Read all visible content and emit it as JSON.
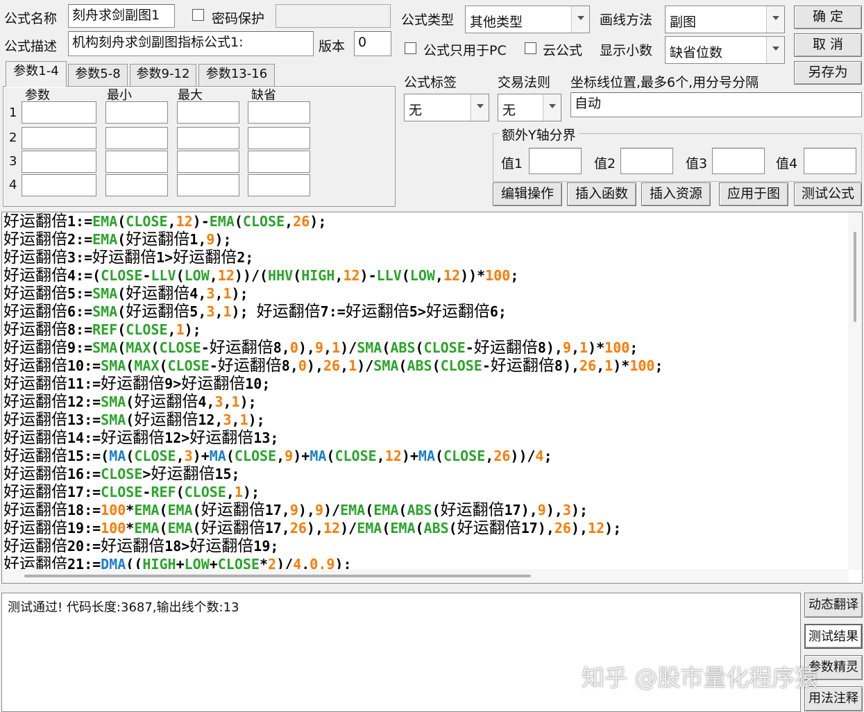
{
  "header": {
    "name_label": "公式名称",
    "name_value": "刻舟求剑副图1",
    "password_label": "密码保护",
    "password_value": "",
    "desc_label": "公式描述",
    "desc_value": "机构刻舟求剑副图指标公式1:",
    "version_label": "版本",
    "version_value": "0",
    "type_label": "公式类型",
    "type_value": "其他类型",
    "draw_label": "画线方法",
    "draw_value": "副图",
    "pc_only_label": "公式只用于PC",
    "cloud_label": "云公式",
    "decimals_label": "显示小数",
    "decimals_value": "缺省位数",
    "tag_label": "公式标签",
    "tag_value": "无",
    "trade_label": "交易法则",
    "trade_value": "无",
    "axis_label": "坐标线位置,最多6个,用分号分隔",
    "axis_value": "自动",
    "extra_y_label": "额外Y轴分界",
    "extra_y": [
      "值1",
      "值2",
      "值3",
      "值4"
    ]
  },
  "buttons": {
    "ok": "确 定",
    "cancel": "取 消",
    "save_as": "另存为",
    "edit_op": "编辑操作",
    "insert_fn": "插入函数",
    "insert_res": "插入资源",
    "apply": "应用于图",
    "test": "测试公式"
  },
  "tabs": [
    "参数1-4",
    "参数5-8",
    "参数9-12",
    "参数13-16"
  ],
  "params": {
    "headers": [
      "参数",
      "最小",
      "最大",
      "缺省"
    ],
    "rows": [
      "1",
      "2",
      "3",
      "4"
    ]
  },
  "code_lines": [
    [
      [
        "cn",
        "好运翻倍"
      ],
      [
        "t",
        "1:="
      ],
      [
        "kw",
        "EMA"
      ],
      [
        "t",
        "("
      ],
      [
        "kw",
        "CLOSE"
      ],
      [
        "t",
        ","
      ],
      [
        "num",
        "12"
      ],
      [
        "t",
        ")-"
      ],
      [
        "kw",
        "EMA"
      ],
      [
        "t",
        "("
      ],
      [
        "kw",
        "CLOSE"
      ],
      [
        "t",
        ","
      ],
      [
        "num",
        "26"
      ],
      [
        "t",
        ");"
      ]
    ],
    [
      [
        "cn",
        "好运翻倍"
      ],
      [
        "t",
        "2:="
      ],
      [
        "kw",
        "EMA"
      ],
      [
        "t",
        "("
      ],
      [
        "cn",
        "好运翻倍"
      ],
      [
        "t",
        "1,"
      ],
      [
        "num",
        "9"
      ],
      [
        "t",
        ");"
      ]
    ],
    [
      [
        "cn",
        "好运翻倍"
      ],
      [
        "t",
        "3:="
      ],
      [
        "cn",
        "好运翻倍"
      ],
      [
        "t",
        "1>"
      ],
      [
        "cn",
        "好运翻倍"
      ],
      [
        "t",
        "2;"
      ]
    ],
    [
      [
        "cn",
        "好运翻倍"
      ],
      [
        "t",
        "4:=("
      ],
      [
        "kw",
        "CLOSE"
      ],
      [
        "t",
        "-"
      ],
      [
        "kw",
        "LLV"
      ],
      [
        "t",
        "("
      ],
      [
        "kw",
        "LOW"
      ],
      [
        "t",
        ","
      ],
      [
        "num",
        "12"
      ],
      [
        "t",
        "))/("
      ],
      [
        "kw",
        "HHV"
      ],
      [
        "t",
        "("
      ],
      [
        "kw",
        "HIGH"
      ],
      [
        "t",
        ","
      ],
      [
        "num",
        "12"
      ],
      [
        "t",
        ")-"
      ],
      [
        "kw",
        "LLV"
      ],
      [
        "t",
        "("
      ],
      [
        "kw",
        "LOW"
      ],
      [
        "t",
        ","
      ],
      [
        "num",
        "12"
      ],
      [
        "t",
        "))*"
      ],
      [
        "num",
        "100"
      ],
      [
        "t",
        ";"
      ]
    ],
    [
      [
        "cn",
        "好运翻倍"
      ],
      [
        "t",
        "5:="
      ],
      [
        "kw",
        "SMA"
      ],
      [
        "t",
        "("
      ],
      [
        "cn",
        "好运翻倍"
      ],
      [
        "t",
        "4,"
      ],
      [
        "num",
        "3"
      ],
      [
        "t",
        ","
      ],
      [
        "num",
        "1"
      ],
      [
        "t",
        ");"
      ]
    ],
    [
      [
        "cn",
        "好运翻倍"
      ],
      [
        "t",
        "6:="
      ],
      [
        "kw",
        "SMA"
      ],
      [
        "t",
        "("
      ],
      [
        "cn",
        "好运翻倍"
      ],
      [
        "t",
        "5,"
      ],
      [
        "num",
        "3"
      ],
      [
        "t",
        ","
      ],
      [
        "num",
        "1"
      ],
      [
        "t",
        "); "
      ],
      [
        "cn",
        "好运翻倍"
      ],
      [
        "t",
        "7:="
      ],
      [
        "cn",
        "好运翻倍"
      ],
      [
        "t",
        "5>"
      ],
      [
        "cn",
        "好运翻倍"
      ],
      [
        "t",
        "6;"
      ]
    ],
    [
      [
        "cn",
        "好运翻倍"
      ],
      [
        "t",
        "8:="
      ],
      [
        "kw",
        "REF"
      ],
      [
        "t",
        "("
      ],
      [
        "kw",
        "CLOSE"
      ],
      [
        "t",
        ","
      ],
      [
        "num",
        "1"
      ],
      [
        "t",
        ");"
      ]
    ],
    [
      [
        "cn",
        "好运翻倍"
      ],
      [
        "t",
        "9:="
      ],
      [
        "kw",
        "SMA"
      ],
      [
        "t",
        "("
      ],
      [
        "kw",
        "MAX"
      ],
      [
        "t",
        "("
      ],
      [
        "kw",
        "CLOSE"
      ],
      [
        "t",
        "-"
      ],
      [
        "cn",
        "好运翻倍"
      ],
      [
        "t",
        "8,"
      ],
      [
        "num",
        "0"
      ],
      [
        "t",
        "),"
      ],
      [
        "num",
        "9"
      ],
      [
        "t",
        ","
      ],
      [
        "num",
        "1"
      ],
      [
        "t",
        ")/"
      ],
      [
        "kw",
        "SMA"
      ],
      [
        "t",
        "("
      ],
      [
        "kw",
        "ABS"
      ],
      [
        "t",
        "("
      ],
      [
        "kw",
        "CLOSE"
      ],
      [
        "t",
        "-"
      ],
      [
        "cn",
        "好运翻倍"
      ],
      [
        "t",
        "8),"
      ],
      [
        "num",
        "9"
      ],
      [
        "t",
        ","
      ],
      [
        "num",
        "1"
      ],
      [
        "t",
        ")*"
      ],
      [
        "num",
        "100"
      ],
      [
        "t",
        ";"
      ]
    ],
    [
      [
        "cn",
        "好运翻倍"
      ],
      [
        "t",
        "10:="
      ],
      [
        "kw",
        "SMA"
      ],
      [
        "t",
        "("
      ],
      [
        "kw",
        "MAX"
      ],
      [
        "t",
        "("
      ],
      [
        "kw",
        "CLOSE"
      ],
      [
        "t",
        "-"
      ],
      [
        "cn",
        "好运翻倍"
      ],
      [
        "t",
        "8,"
      ],
      [
        "num",
        "0"
      ],
      [
        "t",
        "),"
      ],
      [
        "num",
        "26"
      ],
      [
        "t",
        ","
      ],
      [
        "num",
        "1"
      ],
      [
        "t",
        ")/"
      ],
      [
        "kw",
        "SMA"
      ],
      [
        "t",
        "("
      ],
      [
        "kw",
        "ABS"
      ],
      [
        "t",
        "("
      ],
      [
        "kw",
        "CLOSE"
      ],
      [
        "t",
        "-"
      ],
      [
        "cn",
        "好运翻倍"
      ],
      [
        "t",
        "8),"
      ],
      [
        "num",
        "26"
      ],
      [
        "t",
        ","
      ],
      [
        "num",
        "1"
      ],
      [
        "t",
        ")*"
      ],
      [
        "num",
        "100"
      ],
      [
        "t",
        ";"
      ]
    ],
    [
      [
        "cn",
        "好运翻倍"
      ],
      [
        "t",
        "11:="
      ],
      [
        "cn",
        "好运翻倍"
      ],
      [
        "t",
        "9>"
      ],
      [
        "cn",
        "好运翻倍"
      ],
      [
        "t",
        "10;"
      ]
    ],
    [
      [
        "cn",
        "好运翻倍"
      ],
      [
        "t",
        "12:="
      ],
      [
        "kw",
        "SMA"
      ],
      [
        "t",
        "("
      ],
      [
        "cn",
        "好运翻倍"
      ],
      [
        "t",
        "4,"
      ],
      [
        "num",
        "3"
      ],
      [
        "t",
        ","
      ],
      [
        "num",
        "1"
      ],
      [
        "t",
        ");"
      ]
    ],
    [
      [
        "cn",
        "好运翻倍"
      ],
      [
        "t",
        "13:="
      ],
      [
        "kw",
        "SMA"
      ],
      [
        "t",
        "("
      ],
      [
        "cn",
        "好运翻倍"
      ],
      [
        "t",
        "12,"
      ],
      [
        "num",
        "3"
      ],
      [
        "t",
        ","
      ],
      [
        "num",
        "1"
      ],
      [
        "t",
        ");"
      ]
    ],
    [
      [
        "cn",
        "好运翻倍"
      ],
      [
        "t",
        "14:="
      ],
      [
        "cn",
        "好运翻倍"
      ],
      [
        "t",
        "12>"
      ],
      [
        "cn",
        "好运翻倍"
      ],
      [
        "t",
        "13;"
      ]
    ],
    [
      [
        "cn",
        "好运翻倍"
      ],
      [
        "t",
        "15:=("
      ],
      [
        "fn",
        "MA"
      ],
      [
        "t",
        "("
      ],
      [
        "kw",
        "CLOSE"
      ],
      [
        "t",
        ","
      ],
      [
        "num",
        "3"
      ],
      [
        "t",
        ")+"
      ],
      [
        "fn",
        "MA"
      ],
      [
        "t",
        "("
      ],
      [
        "kw",
        "CLOSE"
      ],
      [
        "t",
        ","
      ],
      [
        "num",
        "9"
      ],
      [
        "t",
        ")+"
      ],
      [
        "fn",
        "MA"
      ],
      [
        "t",
        "("
      ],
      [
        "kw",
        "CLOSE"
      ],
      [
        "t",
        ","
      ],
      [
        "num",
        "12"
      ],
      [
        "t",
        ")+"
      ],
      [
        "fn",
        "MA"
      ],
      [
        "t",
        "("
      ],
      [
        "kw",
        "CLOSE"
      ],
      [
        "t",
        ","
      ],
      [
        "num",
        "26"
      ],
      [
        "t",
        "))/"
      ],
      [
        "num",
        "4"
      ],
      [
        "t",
        ";"
      ]
    ],
    [
      [
        "cn",
        "好运翻倍"
      ],
      [
        "t",
        "16:="
      ],
      [
        "kw",
        "CLOSE"
      ],
      [
        "t",
        ">"
      ],
      [
        "cn",
        "好运翻倍"
      ],
      [
        "t",
        "15;"
      ]
    ],
    [
      [
        "cn",
        "好运翻倍"
      ],
      [
        "t",
        "17:="
      ],
      [
        "kw",
        "CLOSE"
      ],
      [
        "t",
        "-"
      ],
      [
        "kw",
        "REF"
      ],
      [
        "t",
        "("
      ],
      [
        "kw",
        "CLOSE"
      ],
      [
        "t",
        ","
      ],
      [
        "num",
        "1"
      ],
      [
        "t",
        ");"
      ]
    ],
    [
      [
        "cn",
        "好运翻倍"
      ],
      [
        "t",
        "18:="
      ],
      [
        "num",
        "100"
      ],
      [
        "t",
        "*"
      ],
      [
        "kw",
        "EMA"
      ],
      [
        "t",
        "("
      ],
      [
        "kw",
        "EMA"
      ],
      [
        "t",
        "("
      ],
      [
        "cn",
        "好运翻倍"
      ],
      [
        "t",
        "17,"
      ],
      [
        "num",
        "9"
      ],
      [
        "t",
        "),"
      ],
      [
        "num",
        "9"
      ],
      [
        "t",
        ")/"
      ],
      [
        "kw",
        "EMA"
      ],
      [
        "t",
        "("
      ],
      [
        "kw",
        "EMA"
      ],
      [
        "t",
        "("
      ],
      [
        "kw",
        "ABS"
      ],
      [
        "t",
        "("
      ],
      [
        "cn",
        "好运翻倍"
      ],
      [
        "t",
        "17),"
      ],
      [
        "num",
        "9"
      ],
      [
        "t",
        "),"
      ],
      [
        "num",
        "3"
      ],
      [
        "t",
        ");"
      ]
    ],
    [
      [
        "cn",
        "好运翻倍"
      ],
      [
        "t",
        "19:="
      ],
      [
        "num",
        "100"
      ],
      [
        "t",
        "*"
      ],
      [
        "kw",
        "EMA"
      ],
      [
        "t",
        "("
      ],
      [
        "kw",
        "EMA"
      ],
      [
        "t",
        "("
      ],
      [
        "cn",
        "好运翻倍"
      ],
      [
        "t",
        "17,"
      ],
      [
        "num",
        "26"
      ],
      [
        "t",
        "),"
      ],
      [
        "num",
        "12"
      ],
      [
        "t",
        ")/"
      ],
      [
        "kw",
        "EMA"
      ],
      [
        "t",
        "("
      ],
      [
        "kw",
        "EMA"
      ],
      [
        "t",
        "("
      ],
      [
        "kw",
        "ABS"
      ],
      [
        "t",
        "("
      ],
      [
        "cn",
        "好运翻倍"
      ],
      [
        "t",
        "17),"
      ],
      [
        "num",
        "26"
      ],
      [
        "t",
        "),"
      ],
      [
        "num",
        "12"
      ],
      [
        "t",
        ");"
      ]
    ],
    [
      [
        "cn",
        "好运翻倍"
      ],
      [
        "t",
        "20:="
      ],
      [
        "cn",
        "好运翻倍"
      ],
      [
        "t",
        "18>"
      ],
      [
        "cn",
        "好运翻倍"
      ],
      [
        "t",
        "19;"
      ]
    ],
    [
      [
        "cn",
        "好运翻倍"
      ],
      [
        "t",
        "21:="
      ],
      [
        "fn",
        "DMA"
      ],
      [
        "t",
        "(("
      ],
      [
        "kw",
        "HIGH"
      ],
      [
        "t",
        "+"
      ],
      [
        "kw",
        "LOW"
      ],
      [
        "t",
        "+"
      ],
      [
        "kw",
        "CLOSE"
      ],
      [
        "t",
        "*"
      ],
      [
        "num",
        "2"
      ],
      [
        "t",
        ")/"
      ],
      [
        "num",
        "4"
      ],
      [
        "t",
        ","
      ],
      [
        "num",
        "0.9"
      ],
      [
        "t",
        ");"
      ]
    ]
  ],
  "output": {
    "message": "测试通过! 代码长度:3687,输出线个数:13"
  },
  "side_buttons": [
    "动态翻译",
    "测试结果",
    "参数精灵",
    "用法注释"
  ],
  "watermark": "知乎 @股市量化程序猿"
}
